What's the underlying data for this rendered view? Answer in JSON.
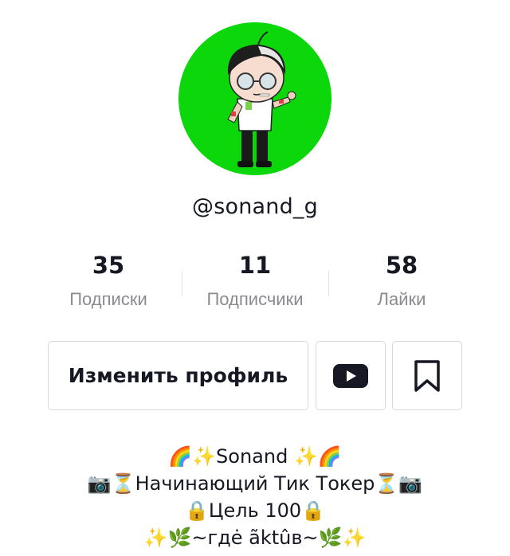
{
  "profile": {
    "username": "@sonand_g",
    "avatar_bg": "#0bd70b"
  },
  "stats": [
    {
      "value": "35",
      "label": "Подписки"
    },
    {
      "value": "11",
      "label": "Подписчики"
    },
    {
      "value": "58",
      "label": "Лайки"
    }
  ],
  "actions": {
    "edit_label": "Изменить профиль",
    "youtube_icon": "youtube-icon",
    "bookmark_icon": "bookmark-icon"
  },
  "bio": {
    "lines": [
      "🌈✨Sonand ✨🌈",
      "📷⏳Начинающий Тик Токер⏳📷",
      "🔒Цель 100🔒",
      "✨🌿~гдė ãktûв~🌿✨"
    ]
  },
  "colors": {
    "text_primary": "#161823",
    "text_secondary": "#8a8b91",
    "border": "#d8d8da"
  }
}
